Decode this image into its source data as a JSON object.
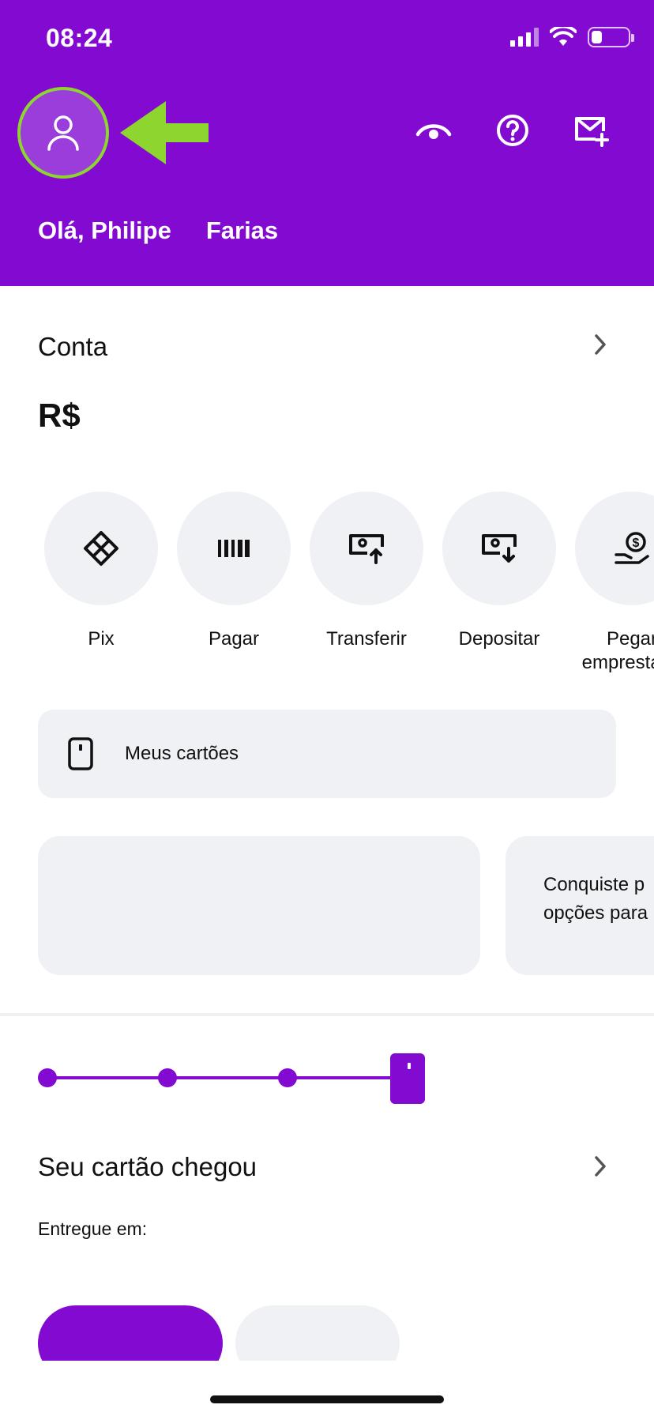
{
  "status_bar": {
    "time": "08:24"
  },
  "header": {
    "greeting_first": "Olá, Philipe",
    "greeting_last": "Farias",
    "icons": [
      "profile-icon",
      "eye-icon",
      "help-icon",
      "mail-plus-icon"
    ]
  },
  "account": {
    "title": "Conta",
    "balance": "R$"
  },
  "shortcuts": [
    {
      "label": "Pix",
      "icon": "pix-icon"
    },
    {
      "label": "Pagar",
      "icon": "barcode-icon"
    },
    {
      "label": "Transferir",
      "icon": "money-upload-icon"
    },
    {
      "label": "Depositar",
      "icon": "money-download-icon"
    },
    {
      "label": "Pegar\nemprestado",
      "icon": "hand-coin-icon"
    }
  ],
  "cards_button": {
    "label": "Meus cartões"
  },
  "promo": {
    "text_line1": "Conquiste p",
    "text_line2": "opções para"
  },
  "card_status": {
    "title": "Seu cartão chegou",
    "delivered_label": "Entregue em:"
  },
  "colors": {
    "brand": "#820ad1",
    "annotation": "#8dd630",
    "surface": "#f0f1f5"
  }
}
